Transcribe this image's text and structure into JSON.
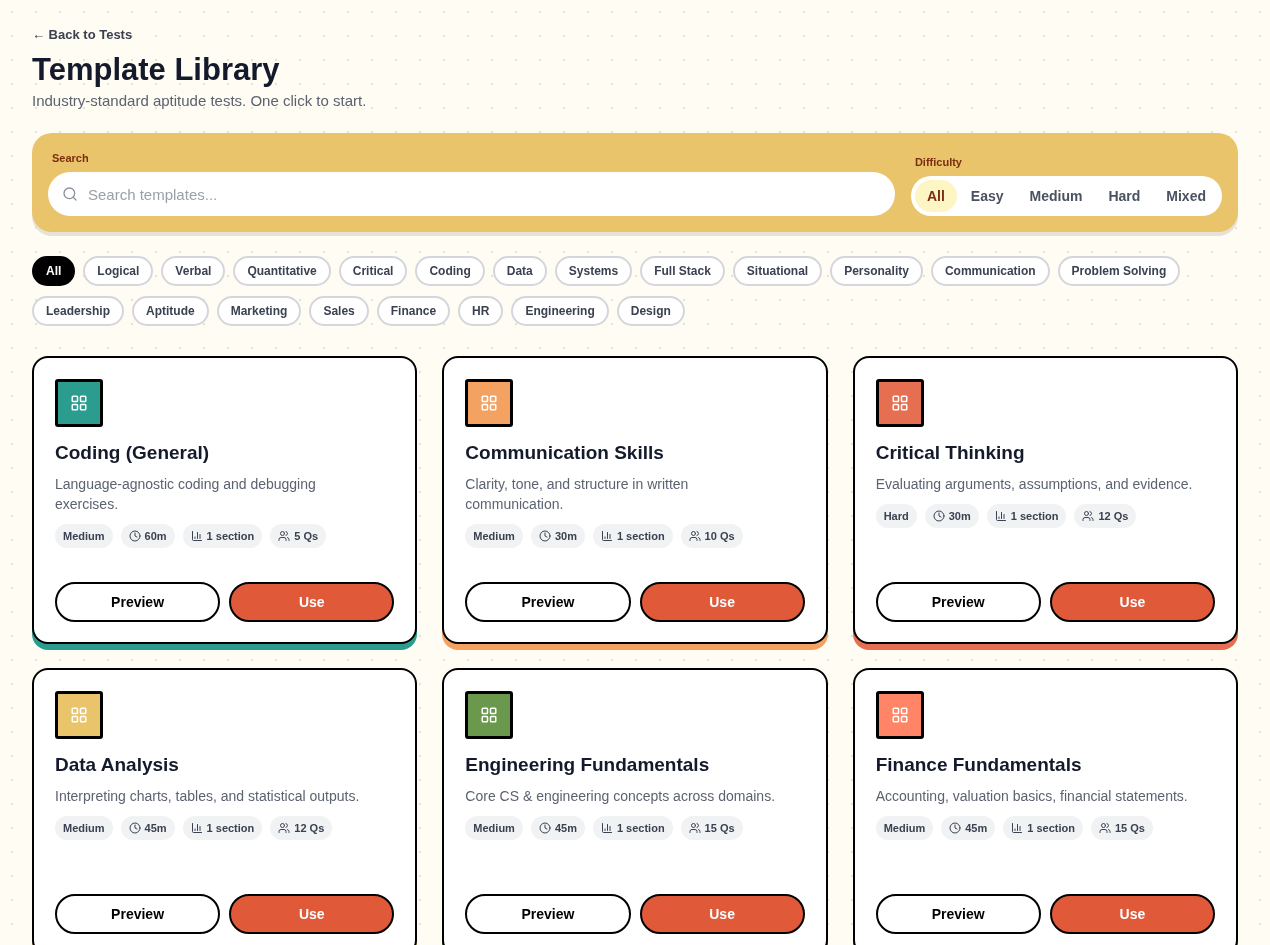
{
  "back_link": "← Back to Tests",
  "title": "Template Library",
  "subtitle": "Industry-standard aptitude tests. One click to start.",
  "search": {
    "label": "Search",
    "placeholder": "Search templates..."
  },
  "difficulty": {
    "label": "Difficulty",
    "options": [
      {
        "label": "All",
        "selected": true
      },
      {
        "label": "Easy",
        "selected": false
      },
      {
        "label": "Medium",
        "selected": false
      },
      {
        "label": "Hard",
        "selected": false
      },
      {
        "label": "Mixed",
        "selected": false
      }
    ]
  },
  "categories": [
    {
      "label": "All",
      "selected": true
    },
    {
      "label": "Logical",
      "selected": false
    },
    {
      "label": "Verbal",
      "selected": false
    },
    {
      "label": "Quantitative",
      "selected": false
    },
    {
      "label": "Critical",
      "selected": false
    },
    {
      "label": "Coding",
      "selected": false
    },
    {
      "label": "Data",
      "selected": false
    },
    {
      "label": "Systems",
      "selected": false
    },
    {
      "label": "Full Stack",
      "selected": false
    },
    {
      "label": "Situational",
      "selected": false
    },
    {
      "label": "Personality",
      "selected": false
    },
    {
      "label": "Communication",
      "selected": false
    },
    {
      "label": "Problem Solving",
      "selected": false
    },
    {
      "label": "Leadership",
      "selected": false
    },
    {
      "label": "Aptitude",
      "selected": false
    },
    {
      "label": "Marketing",
      "selected": false
    },
    {
      "label": "Sales",
      "selected": false
    },
    {
      "label": "Finance",
      "selected": false
    },
    {
      "label": "HR",
      "selected": false
    },
    {
      "label": "Engineering",
      "selected": false
    },
    {
      "label": "Design",
      "selected": false
    }
  ],
  "templates": [
    {
      "title": "Coding (General)",
      "description": "Language-agnostic coding and debugging exercises.",
      "color": "#2a9d8f",
      "difficulty": "Medium",
      "duration": "60m",
      "sections": "1 section",
      "questions": "5 Qs",
      "buttons": [
        "Preview",
        "Use"
      ]
    },
    {
      "title": "Communication Skills",
      "description": "Clarity, tone, and structure in written communication.",
      "color": "#f4a261",
      "difficulty": "Medium",
      "duration": "30m",
      "sections": "1 section",
      "questions": "10 Qs",
      "buttons": [
        "Preview",
        "Use"
      ]
    },
    {
      "title": "Critical Thinking",
      "description": "Evaluating arguments, assumptions, and evidence.",
      "color": "#e76f51",
      "difficulty": "Hard",
      "duration": "30m",
      "sections": "1 section",
      "questions": "12 Qs",
      "buttons": [
        "Preview",
        "Use"
      ]
    },
    {
      "title": "Data Analysis",
      "description": "Interpreting charts, tables, and statistical outputs.",
      "color": "#e9c46a",
      "difficulty": "Medium",
      "duration": "45m",
      "sections": "1 section",
      "questions": "12 Qs",
      "buttons": [
        "Preview",
        "Use"
      ]
    },
    {
      "title": "Engineering Fundamentals",
      "description": "Core CS & engineering concepts across domains.",
      "color": "#6a994e",
      "difficulty": "Medium",
      "duration": "45m",
      "sections": "1 section",
      "questions": "15 Qs",
      "buttons": [
        "Preview",
        "Use"
      ]
    },
    {
      "title": "Finance Fundamentals",
      "description": "Accounting, valuation basics, financial statements.",
      "color": "#ff8566",
      "difficulty": "Medium",
      "duration": "45m",
      "sections": "1 section",
      "questions": "15 Qs",
      "buttons": [
        "Preview",
        "Use"
      ]
    }
  ]
}
